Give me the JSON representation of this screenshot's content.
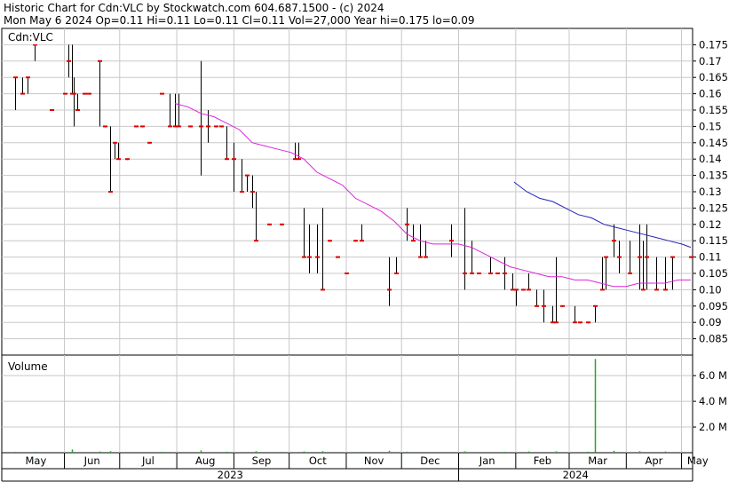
{
  "header": {
    "line1": "Historic Chart for Cdn:VLC by Stockwatch.com 604.687.1500 - (c) 2024",
    "line2": "Mon May  6 2024   Op=0.11  Hi=0.11  Lo=0.11  Cl=0.11  Vol=27,000  Year hi=0.175  lo=0.09"
  },
  "colors": {
    "price_bar": "#000000",
    "close_tick": "#dd0000",
    "ma_short": "#dd22dd",
    "ma_long": "#2222bb",
    "volume": "#22aa22",
    "grid": "#c8c8c8"
  },
  "chart_data": [
    {
      "type": "line",
      "panel": "price",
      "title": "Cdn:VLC",
      "ylim": [
        0.08,
        0.18
      ],
      "y_ticks": [
        "0.175",
        "0.17",
        "0.165",
        "0.16",
        "0.155",
        "0.15",
        "0.145",
        "0.14",
        "0.135",
        "0.13",
        "0.125",
        "0.12",
        "0.115",
        "0.11",
        "0.105",
        "0.10",
        "0.095",
        "0.09",
        "0.085"
      ],
      "x_labels": [
        "May",
        "Jun",
        "Jul",
        "Aug",
        "Sep",
        "Oct",
        "Nov",
        "Dec",
        "Jan",
        "Feb",
        "Mar",
        "Apr",
        "May"
      ],
      "year_labels": [
        "2023",
        "2024"
      ],
      "bar_fields": [
        "date",
        "high",
        "low",
        "close"
      ],
      "bars": [
        [
          "2023-05-05",
          0.165,
          0.155,
          0.165
        ],
        [
          "2023-05-09",
          0.165,
          0.16,
          0.16
        ],
        [
          "2023-05-12",
          0.165,
          0.16,
          0.165
        ],
        [
          "2023-05-16",
          0.175,
          0.17,
          0.175
        ],
        [
          "2023-05-25",
          0.155,
          0.155,
          0.155
        ],
        [
          "2023-06-01",
          0.16,
          0.16,
          0.16
        ],
        [
          "2023-06-03",
          0.175,
          0.165,
          0.17
        ],
        [
          "2023-06-05",
          0.175,
          0.16,
          0.16
        ],
        [
          "2023-06-06",
          0.165,
          0.15,
          0.16
        ],
        [
          "2023-06-08",
          0.16,
          0.155,
          0.155
        ],
        [
          "2023-06-12",
          0.16,
          0.16,
          0.16
        ],
        [
          "2023-06-14",
          0.16,
          0.16,
          0.16
        ],
        [
          "2023-06-20",
          0.17,
          0.15,
          0.17
        ],
        [
          "2023-06-23",
          0.15,
          0.15,
          0.15
        ],
        [
          "2023-06-26",
          0.15,
          0.13,
          0.13
        ],
        [
          "2023-06-28",
          0.145,
          0.14,
          0.145
        ],
        [
          "2023-06-30",
          0.145,
          0.14,
          0.14
        ],
        [
          "2023-07-05",
          0.14,
          0.14,
          0.14
        ],
        [
          "2023-07-10",
          0.15,
          0.15,
          0.15
        ],
        [
          "2023-07-13",
          0.15,
          0.15,
          0.15
        ],
        [
          "2023-07-17",
          0.145,
          0.145,
          0.145
        ],
        [
          "2023-07-24",
          0.16,
          0.16,
          0.16
        ],
        [
          "2023-07-28",
          0.16,
          0.15,
          0.15
        ],
        [
          "2023-07-31",
          0.16,
          0.15,
          0.15
        ],
        [
          "2023-08-02",
          0.16,
          0.15,
          0.15
        ],
        [
          "2023-08-08",
          0.15,
          0.15,
          0.15
        ],
        [
          "2023-08-14",
          0.17,
          0.135,
          0.15
        ],
        [
          "2023-08-18",
          0.155,
          0.145,
          0.15
        ],
        [
          "2023-08-22",
          0.15,
          0.15,
          0.15
        ],
        [
          "2023-08-25",
          0.15,
          0.15,
          0.15
        ],
        [
          "2023-08-28",
          0.15,
          0.14,
          0.14
        ],
        [
          "2023-09-01",
          0.145,
          0.13,
          0.14
        ],
        [
          "2023-09-05",
          0.14,
          0.13,
          0.13
        ],
        [
          "2023-09-08",
          0.135,
          0.13,
          0.135
        ],
        [
          "2023-09-11",
          0.135,
          0.125,
          0.13
        ],
        [
          "2023-09-13",
          0.13,
          0.115,
          0.115
        ],
        [
          "2023-09-20",
          0.12,
          0.12,
          0.12
        ],
        [
          "2023-09-27",
          0.12,
          0.12,
          0.12
        ],
        [
          "2023-10-04",
          0.145,
          0.14,
          0.14
        ],
        [
          "2023-10-06",
          0.145,
          0.14,
          0.14
        ],
        [
          "2023-10-09",
          0.125,
          0.11,
          0.11
        ],
        [
          "2023-10-12",
          0.12,
          0.105,
          0.11
        ],
        [
          "2023-10-16",
          0.12,
          0.105,
          0.11
        ],
        [
          "2023-10-19",
          0.125,
          0.1,
          0.1
        ],
        [
          "2023-10-23",
          0.115,
          0.115,
          0.115
        ],
        [
          "2023-10-27",
          0.11,
          0.11,
          0.11
        ],
        [
          "2023-11-01",
          0.105,
          0.105,
          0.105
        ],
        [
          "2023-11-06",
          0.115,
          0.115,
          0.115
        ],
        [
          "2023-11-09",
          0.12,
          0.115,
          0.115
        ],
        [
          "2023-11-24",
          0.11,
          0.095,
          0.1
        ],
        [
          "2023-11-28",
          0.11,
          0.105,
          0.105
        ],
        [
          "2023-12-04",
          0.125,
          0.115,
          0.12
        ],
        [
          "2023-12-07",
          0.12,
          0.115,
          0.115
        ],
        [
          "2023-12-11",
          0.12,
          0.11,
          0.11
        ],
        [
          "2023-12-14",
          0.115,
          0.11,
          0.11
        ],
        [
          "2023-12-28",
          0.12,
          0.11,
          0.115
        ],
        [
          "2024-01-04",
          0.125,
          0.1,
          0.105
        ],
        [
          "2024-01-08",
          0.115,
          0.105,
          0.105
        ],
        [
          "2024-01-12",
          0.105,
          0.105,
          0.105
        ],
        [
          "2024-01-18",
          0.11,
          0.105,
          0.105
        ],
        [
          "2024-01-22",
          0.105,
          0.105,
          0.105
        ],
        [
          "2024-01-26",
          0.11,
          0.1,
          0.105
        ],
        [
          "2024-01-30",
          0.105,
          0.1,
          0.1
        ],
        [
          "2024-02-01",
          0.1,
          0.095,
          0.1
        ],
        [
          "2024-02-05",
          0.1,
          0.1,
          0.1
        ],
        [
          "2024-02-08",
          0.105,
          0.1,
          0.1
        ],
        [
          "2024-02-12",
          0.1,
          0.095,
          0.095
        ],
        [
          "2024-02-16",
          0.1,
          0.09,
          0.095
        ],
        [
          "2024-02-21",
          0.095,
          0.09,
          0.09
        ],
        [
          "2024-02-23",
          0.11,
          0.09,
          0.09
        ],
        [
          "2024-02-26",
          0.095,
          0.095,
          0.095
        ],
        [
          "2024-03-04",
          0.095,
          0.09,
          0.09
        ],
        [
          "2024-03-07",
          0.09,
          0.09,
          0.09
        ],
        [
          "2024-03-11",
          0.09,
          0.09,
          0.09
        ],
        [
          "2024-03-15",
          0.095,
          0.09,
          0.095
        ],
        [
          "2024-03-19",
          0.11,
          0.1,
          0.1
        ],
        [
          "2024-03-21",
          0.11,
          0.1,
          0.11
        ],
        [
          "2024-03-25",
          0.12,
          0.11,
          0.115
        ],
        [
          "2024-03-28",
          0.115,
          0.105,
          0.11
        ],
        [
          "2024-04-03",
          0.115,
          0.105,
          0.105
        ],
        [
          "2024-04-08",
          0.12,
          0.1,
          0.11
        ],
        [
          "2024-04-10",
          0.115,
          0.1,
          0.1
        ],
        [
          "2024-04-12",
          0.12,
          0.1,
          0.11
        ],
        [
          "2024-04-17",
          0.11,
          0.1,
          0.1
        ],
        [
          "2024-04-22",
          0.11,
          0.1,
          0.1
        ],
        [
          "2024-04-26",
          0.11,
          0.1,
          0.11
        ],
        [
          "2024-05-06",
          0.11,
          0.11,
          0.11
        ]
      ],
      "series": [
        {
          "color": "#dd22dd",
          "points": [
            [
              "2023-07-31",
              0.157
            ],
            [
              "2023-08-07",
              0.156
            ],
            [
              "2023-08-14",
              0.154
            ],
            [
              "2023-08-21",
              0.153
            ],
            [
              "2023-08-28",
              0.151
            ],
            [
              "2023-09-04",
              0.149
            ],
            [
              "2023-09-11",
              0.145
            ],
            [
              "2023-09-18",
              0.144
            ],
            [
              "2023-09-25",
              0.143
            ],
            [
              "2023-10-02",
              0.142
            ],
            [
              "2023-10-09",
              0.14
            ],
            [
              "2023-10-16",
              0.136
            ],
            [
              "2023-10-23",
              0.134
            ],
            [
              "2023-10-30",
              0.132
            ],
            [
              "2023-11-06",
              0.128
            ],
            [
              "2023-11-13",
              0.126
            ],
            [
              "2023-11-20",
              0.124
            ],
            [
              "2023-11-27",
              0.121
            ],
            [
              "2023-12-04",
              0.117
            ],
            [
              "2023-12-11",
              0.115
            ],
            [
              "2023-12-18",
              0.114
            ],
            [
              "2023-12-25",
              0.114
            ],
            [
              "2024-01-01",
              0.114
            ],
            [
              "2024-01-08",
              0.113
            ],
            [
              "2024-01-15",
              0.111
            ],
            [
              "2024-01-22",
              0.109
            ],
            [
              "2024-01-29",
              0.107
            ],
            [
              "2024-02-05",
              0.106
            ],
            [
              "2024-02-12",
              0.105
            ],
            [
              "2024-02-19",
              0.104
            ],
            [
              "2024-02-26",
              0.104
            ],
            [
              "2024-03-04",
              0.103
            ],
            [
              "2024-03-11",
              0.103
            ],
            [
              "2024-03-18",
              0.102
            ],
            [
              "2024-03-25",
              0.101
            ],
            [
              "2024-04-01",
              0.101
            ],
            [
              "2024-04-08",
              0.102
            ],
            [
              "2024-04-15",
              0.102
            ],
            [
              "2024-04-22",
              0.102
            ],
            [
              "2024-04-29",
              0.103
            ],
            [
              "2024-05-06",
              0.103
            ]
          ]
        },
        {
          "color": "#2222bb",
          "points": [
            [
              "2024-01-31",
              0.133
            ],
            [
              "2024-02-07",
              0.13
            ],
            [
              "2024-02-14",
              0.128
            ],
            [
              "2024-02-21",
              0.127
            ],
            [
              "2024-02-28",
              0.125
            ],
            [
              "2024-03-06",
              0.123
            ],
            [
              "2024-03-13",
              0.122
            ],
            [
              "2024-03-20",
              0.12
            ],
            [
              "2024-03-27",
              0.119
            ],
            [
              "2024-04-03",
              0.118
            ],
            [
              "2024-04-10",
              0.117
            ],
            [
              "2024-04-17",
              0.116
            ],
            [
              "2024-04-24",
              0.115
            ],
            [
              "2024-05-01",
              0.114
            ],
            [
              "2024-05-06",
              0.113
            ]
          ]
        }
      ]
    },
    {
      "type": "bar",
      "panel": "volume",
      "title": "Volume",
      "ylim": [
        0,
        7600000
      ],
      "y_ticks": [
        "6.0 M",
        "4.0 M",
        "2.0 M"
      ],
      "y_tick_values": [
        6000000,
        4000000,
        2000000
      ],
      "bar_fields": [
        "date",
        "volume"
      ],
      "bars": [
        [
          "2023-05-05",
          40000
        ],
        [
          "2023-05-16",
          60000
        ],
        [
          "2023-06-05",
          250000
        ],
        [
          "2023-06-20",
          90000
        ],
        [
          "2023-06-26",
          120000
        ],
        [
          "2023-07-24",
          60000
        ],
        [
          "2023-08-14",
          180000
        ],
        [
          "2023-08-28",
          80000
        ],
        [
          "2023-09-13",
          120000
        ],
        [
          "2023-09-27",
          60000
        ],
        [
          "2023-10-09",
          100000
        ],
        [
          "2023-10-19",
          120000
        ],
        [
          "2023-11-09",
          60000
        ],
        [
          "2023-11-24",
          150000
        ],
        [
          "2023-12-04",
          80000
        ],
        [
          "2024-01-04",
          110000
        ],
        [
          "2024-01-26",
          60000
        ],
        [
          "2024-02-08",
          100000
        ],
        [
          "2024-02-23",
          110000
        ],
        [
          "2024-03-11",
          80000
        ],
        [
          "2024-03-15",
          7300000
        ],
        [
          "2024-03-25",
          150000
        ],
        [
          "2024-04-08",
          120000
        ],
        [
          "2024-04-22",
          100000
        ],
        [
          "2024-05-06",
          27000
        ]
      ]
    }
  ]
}
